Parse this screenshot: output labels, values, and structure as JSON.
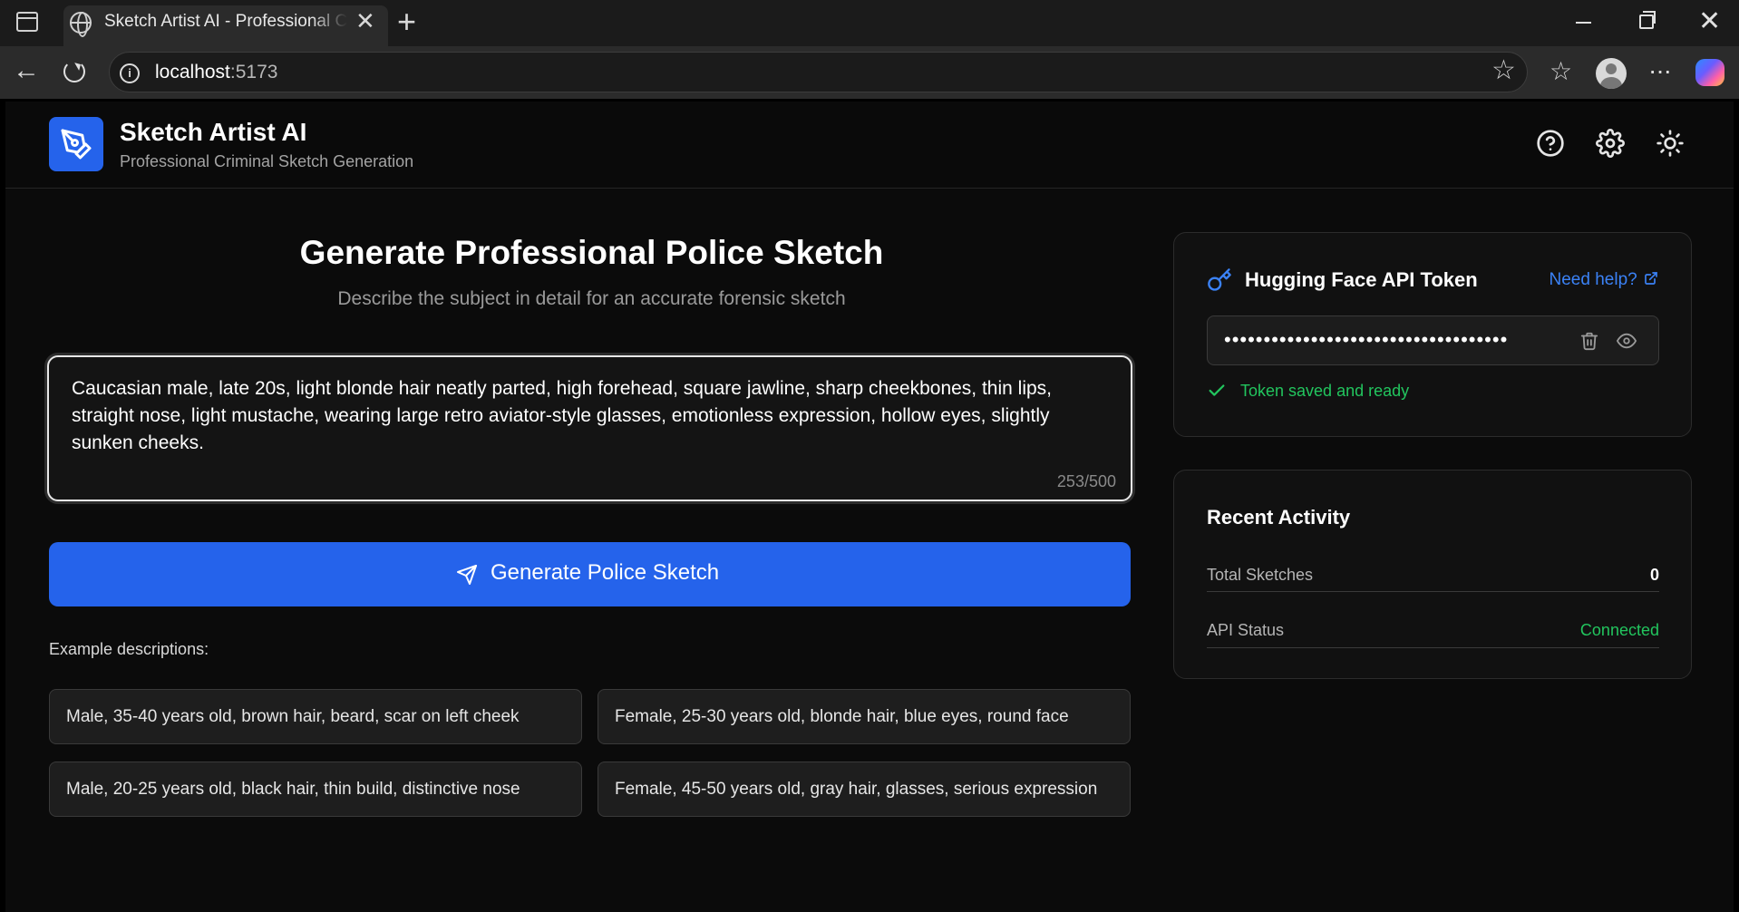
{
  "browser": {
    "tab_title": "Sketch Artist AI - Professional Criminal Sketch Generation",
    "url_host": "localhost",
    "url_port": ":5173"
  },
  "header": {
    "title": "Sketch Artist AI",
    "subtitle": "Professional Criminal Sketch Generation"
  },
  "main": {
    "title": "Generate Professional Police Sketch",
    "subtitle": "Describe the subject in detail for an accurate forensic sketch",
    "description": "Caucasian male, late 20s, light blonde hair neatly parted, high forehead, square jawline, sharp cheekbones, thin lips, straight nose, light mustache, wearing large retro aviator-style glasses, emotionless expression, hollow eyes, slightly sunken cheeks.",
    "char_count": "253/500",
    "generate_label": "Generate Police Sketch",
    "examples_label": "Example descriptions:",
    "examples": [
      "Male, 35-40 years old, brown hair, beard, scar on left cheek",
      "Female, 25-30 years old, blonde hair, blue eyes, round face",
      "Male, 20-25 years old, black hair, thin build, distinctive nose",
      "Female, 45-50 years old, gray hair, glasses, serious expression"
    ]
  },
  "token_card": {
    "title": "Hugging Face API Token",
    "help_link": "Need help?",
    "token_masked": "••••••••••••••••••••••••••••••••••••",
    "status": "Token saved and ready"
  },
  "activity": {
    "title": "Recent Activity",
    "rows": [
      {
        "label": "Total Sketches",
        "value": "0"
      },
      {
        "label": "API Status",
        "value": "Connected"
      }
    ]
  },
  "colors": {
    "accent": "#2563eb",
    "success": "#22c55e",
    "link": "#3b82f6"
  }
}
